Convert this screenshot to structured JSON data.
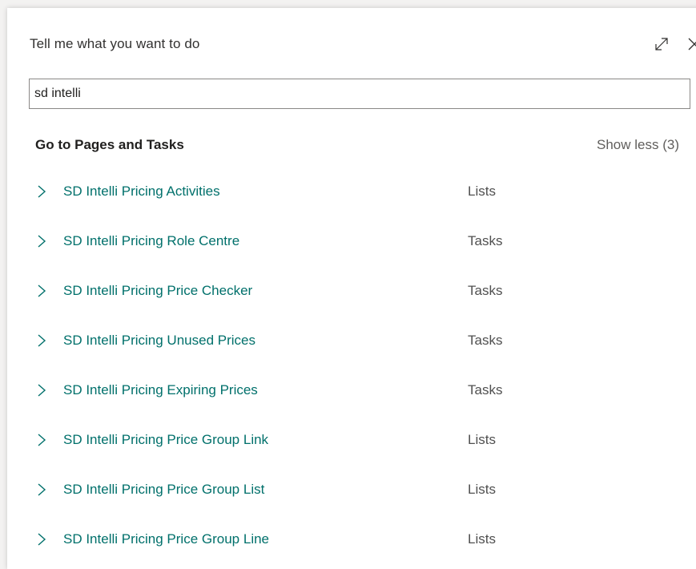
{
  "dialog": {
    "title": "Tell me what you want to do",
    "expand_icon": "expand-icon",
    "close_icon": "close-icon"
  },
  "search": {
    "value": "sd intelli",
    "placeholder": ""
  },
  "section": {
    "title": "Go to Pages and Tasks",
    "show_less_label": "Show less (3)"
  },
  "results": [
    {
      "name": "SD Intelli Pricing Activities",
      "category": "Lists"
    },
    {
      "name": "SD Intelli Pricing Role Centre",
      "category": "Tasks"
    },
    {
      "name": "SD Intelli Pricing Price Checker",
      "category": "Tasks"
    },
    {
      "name": "SD Intelli Pricing Unused Prices",
      "category": "Tasks"
    },
    {
      "name": "SD Intelli Pricing Expiring Prices",
      "category": "Tasks"
    },
    {
      "name": "SD Intelli Pricing Price Group Link",
      "category": "Lists"
    },
    {
      "name": "SD Intelli Pricing Price Group List",
      "category": "Lists"
    },
    {
      "name": "SD Intelli Pricing Price Group Line",
      "category": "Lists"
    }
  ],
  "colors": {
    "link": "#00706b",
    "category": "#505050",
    "chevron": "#00706b"
  }
}
